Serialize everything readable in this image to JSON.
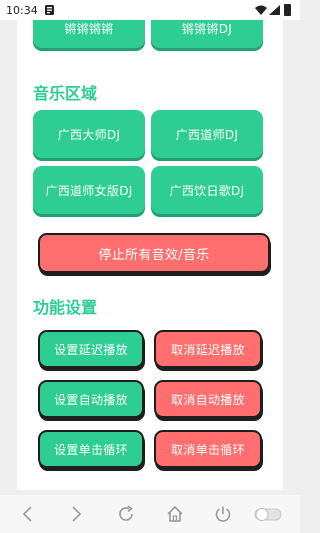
{
  "status_bar": {
    "time": "10:34"
  },
  "top_row": {
    "left": "锵锵锵锵",
    "right": "锵锵锵DJ"
  },
  "music": {
    "title": "音乐区域",
    "items": [
      "广西大师DJ",
      "广西道师DJ",
      "广西道师女版DJ",
      "广西饮日歌DJ"
    ]
  },
  "stop_all": "停止所有音效/音乐",
  "settings": {
    "title": "功能设置",
    "set_delay": "设置延迟播放",
    "cancel_delay": "取消延迟播放",
    "set_auto": "设置自动播放",
    "cancel_auto": "取消自动播放",
    "set_loop": "设置单击循环",
    "cancel_loop": "取消单击循环"
  },
  "colors": {
    "green": "#2dcd93",
    "red": "#ff6f6f"
  }
}
